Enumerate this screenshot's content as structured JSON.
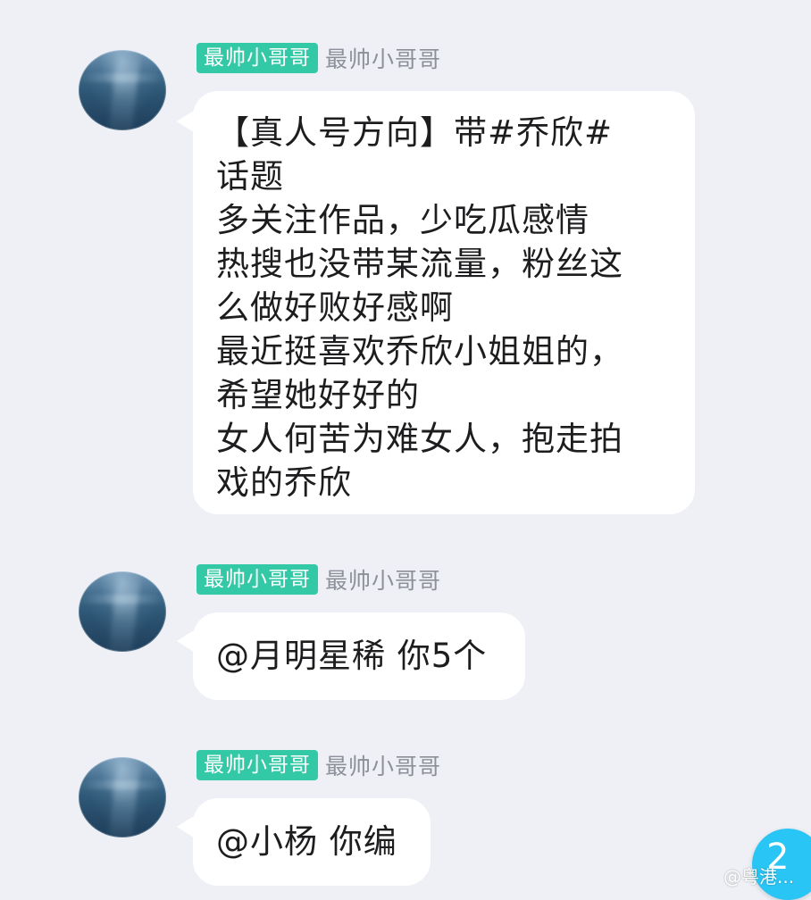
{
  "messages": [
    {
      "badge": "最帅小哥哥",
      "nickname": "最帅小哥哥",
      "lines": [
        "【真人号方向】带#乔欣#",
        "话题",
        "多关注作品，少吃瓜感情",
        "热搜也没带某流量，粉丝这",
        "么做好败好感啊",
        "最近挺喜欢乔欣小姐姐的，",
        "希望她好好的",
        "女人何苦为难女人，抱走拍",
        "戏的乔欣"
      ]
    },
    {
      "badge": "最帅小哥哥",
      "nickname": "最帅小哥哥",
      "lines": [
        "@月明星稀 你5个"
      ]
    },
    {
      "badge": "最帅小哥哥",
      "nickname": "最帅小哥哥",
      "lines": [
        "@小杨 你编"
      ]
    }
  ],
  "unread_count": "2",
  "watermark": "@粤港...",
  "colors": {
    "background": "#eef0f6",
    "badge": "#33c9a6",
    "bubble": "#ffffff",
    "fab": "#29c6f5"
  }
}
